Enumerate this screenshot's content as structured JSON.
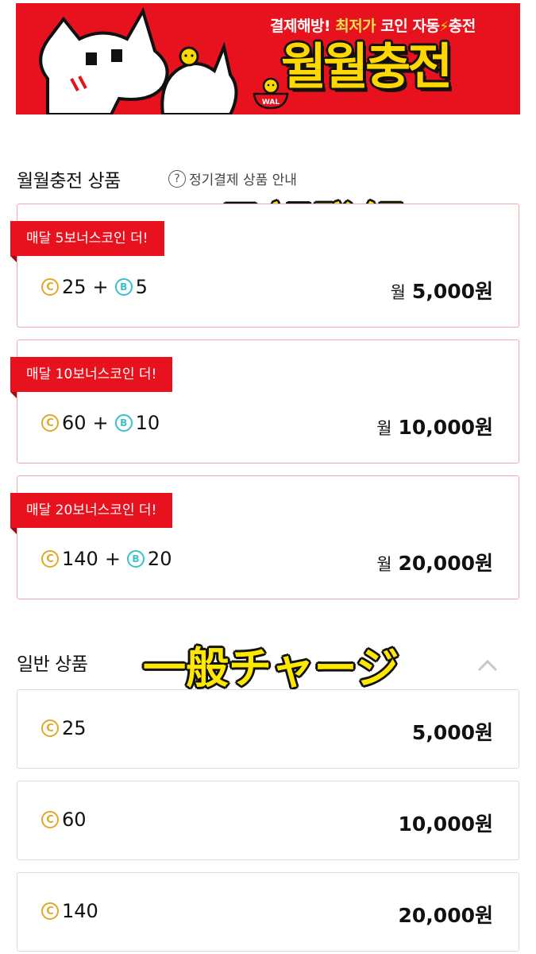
{
  "banner": {
    "tagline_part1": "결제해방!",
    "tagline_highlight": "최저가",
    "tagline_part2": "코인 자동",
    "tagline_part3": "충전",
    "logo_text": "월월충전",
    "bowl_label": "WAL",
    "brand_color": "#e8121e",
    "logo_color": "#ffd800"
  },
  "subscription": {
    "title": "월월충전 상품",
    "help_text": "정기결제 상품 안내",
    "help_icon": "?",
    "overlay_caption": "月額登録",
    "items": [
      {
        "ribbon": "매달 5보너스코인 더!",
        "coins": "25",
        "bonus": "5",
        "month": "월",
        "price": "5,000원"
      },
      {
        "ribbon": "매달 10보너스코인 더!",
        "coins": "60",
        "bonus": "10",
        "month": "월",
        "price": "10,000원"
      },
      {
        "ribbon": "매달 20보너스코인 더!",
        "coins": "140",
        "bonus": "20",
        "month": "월",
        "price": "20,000원"
      }
    ]
  },
  "general": {
    "title": "일반 상품",
    "overlay_caption": "一般チャージ",
    "items": [
      {
        "coins": "25",
        "price": "5,000원"
      },
      {
        "coins": "60",
        "price": "10,000원"
      },
      {
        "coins": "140",
        "price": "20,000원"
      }
    ]
  },
  "symbols": {
    "coin": "C",
    "bonus": "B",
    "plus": "+"
  },
  "colors": {
    "coin": "#e0a92a",
    "bonus": "#38c1cf",
    "ribbon": "#e8121e",
    "overlay": "#ffe800"
  },
  "icons": {
    "help": "question-circle-icon",
    "collapse": "chevron-up-icon",
    "coin": "coin-icon",
    "bonus": "bonus-coin-icon"
  }
}
